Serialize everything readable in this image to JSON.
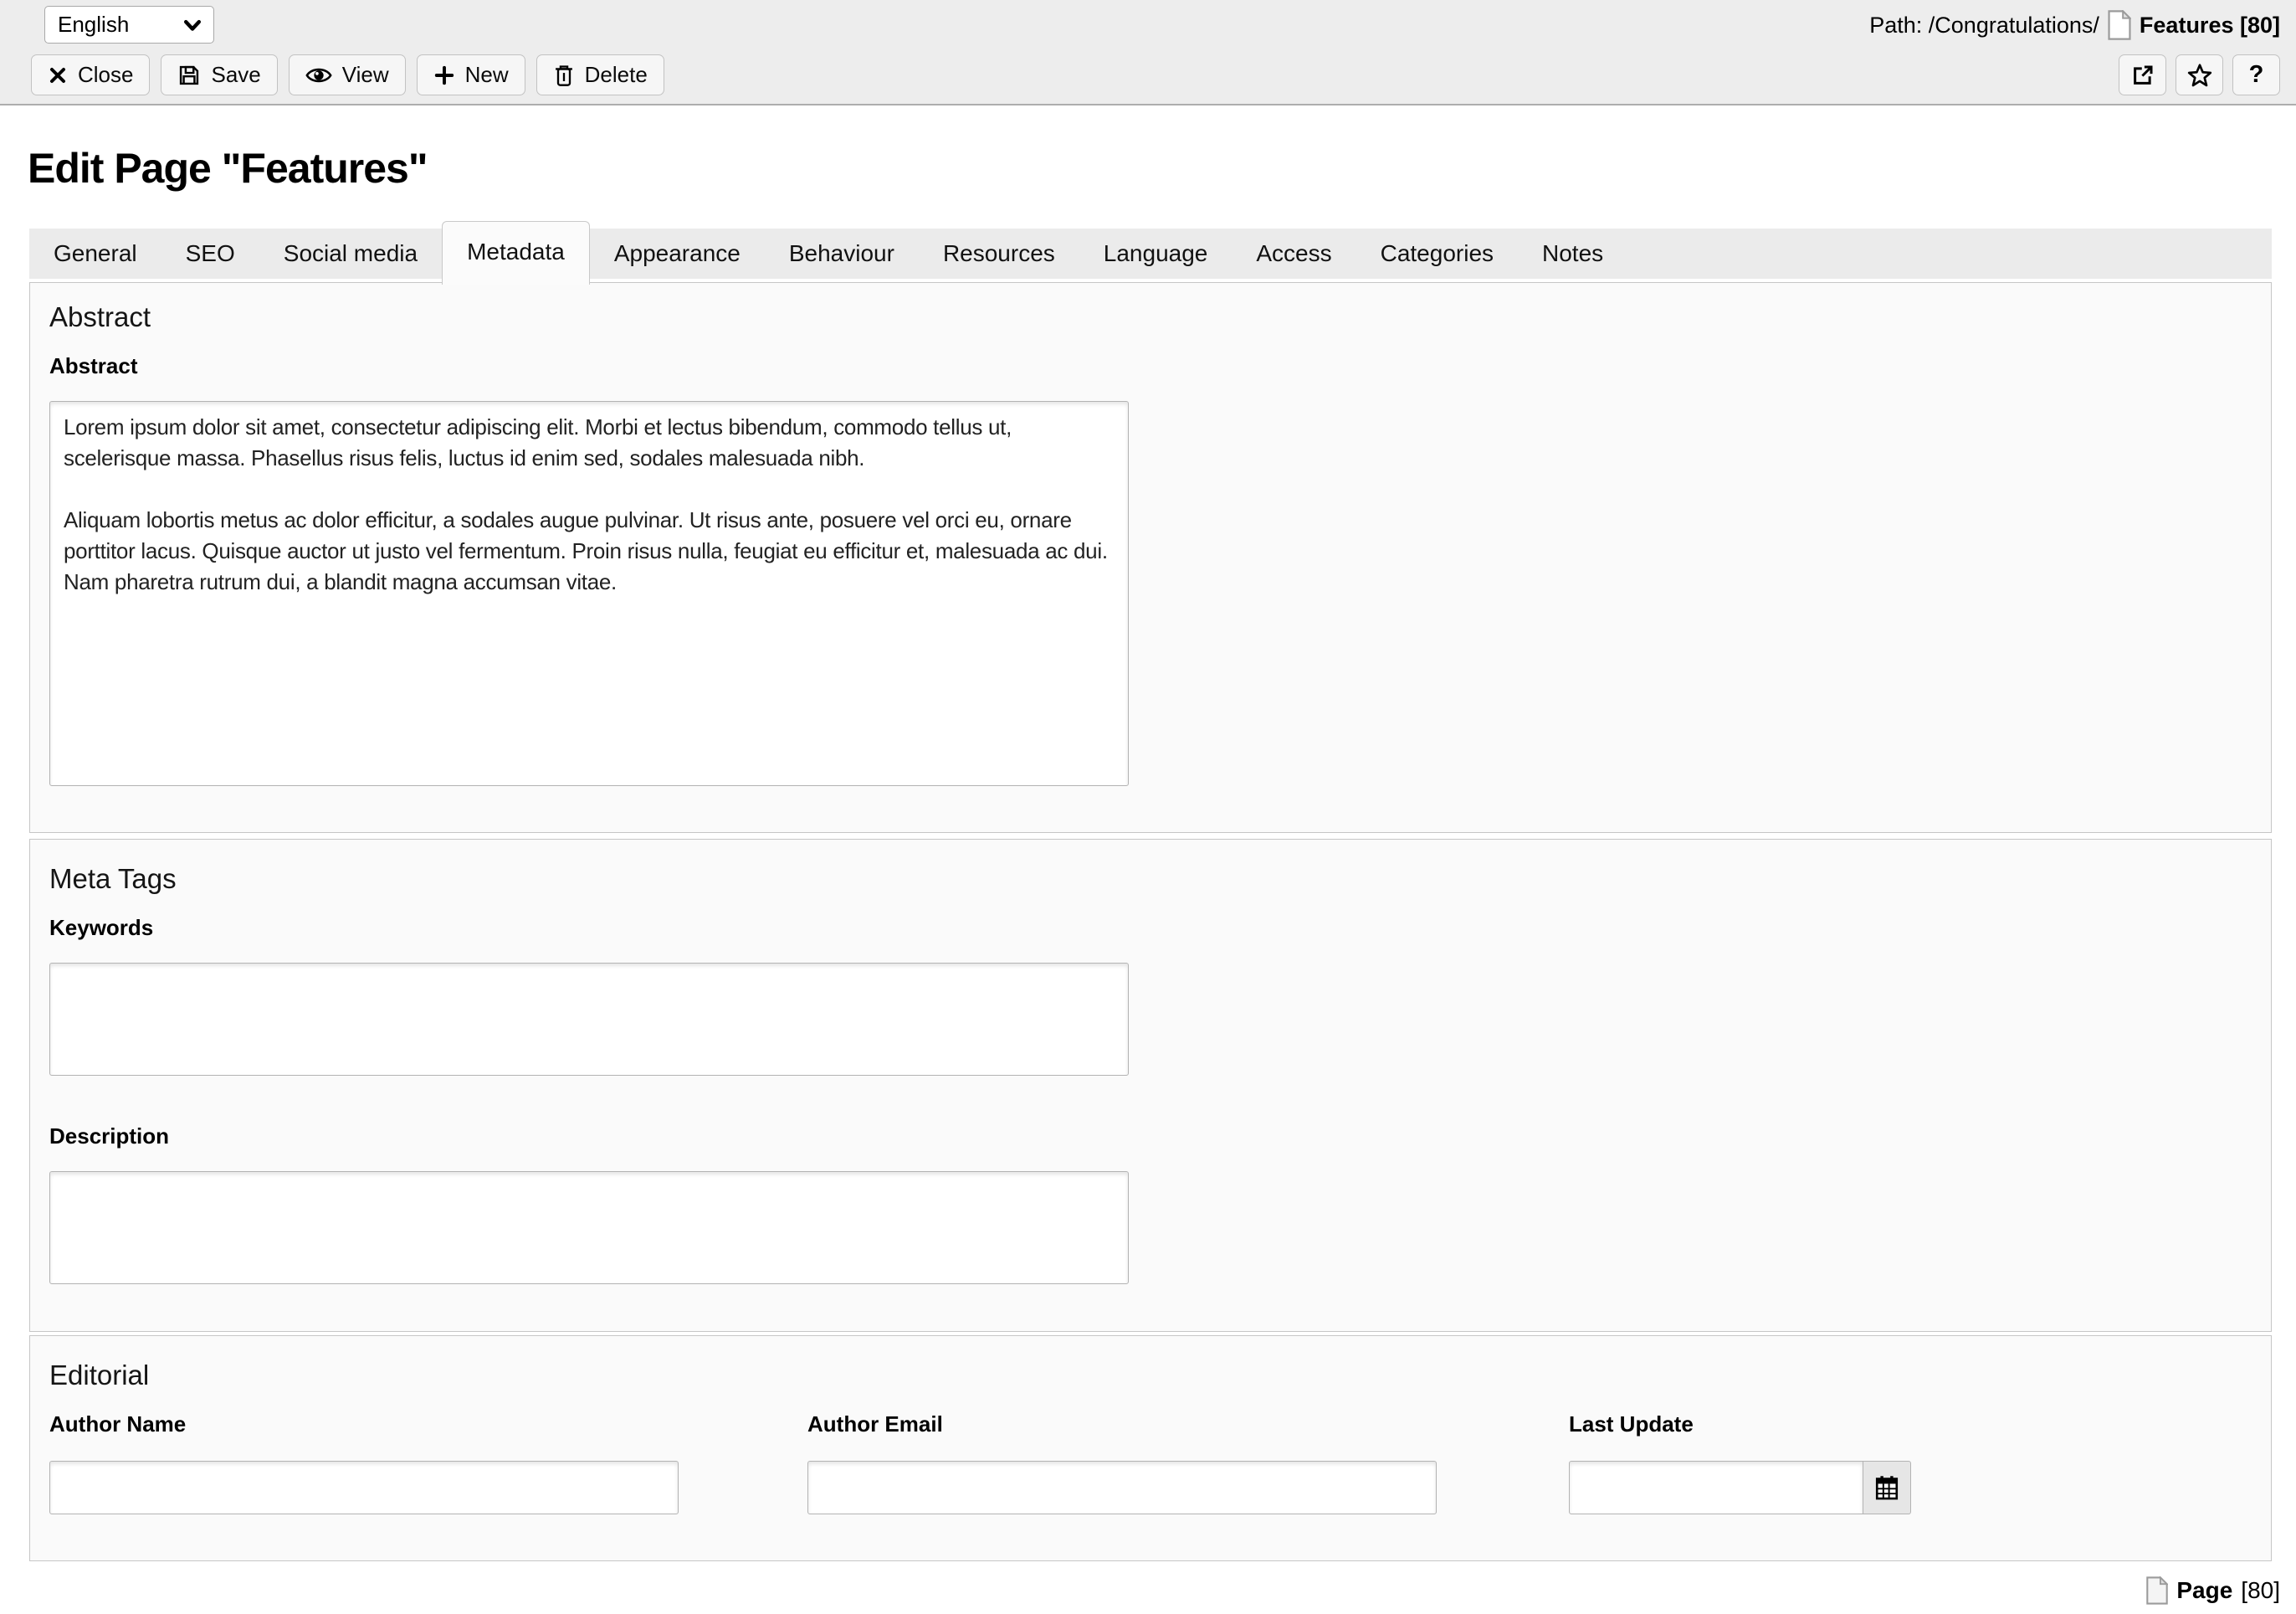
{
  "header": {
    "language": {
      "value": "English"
    },
    "path": {
      "label": "Path: /Congratulations/",
      "record": "Features [80]"
    },
    "toolbar": {
      "buttons": [
        {
          "label": "Close",
          "icon": "close-icon"
        },
        {
          "label": "Save",
          "icon": "save-icon"
        },
        {
          "label": "View",
          "icon": "eye-icon"
        },
        {
          "label": "New",
          "icon": "plus-icon"
        },
        {
          "label": "Delete",
          "icon": "trash-icon"
        }
      ],
      "quick_buttons": [
        {
          "icon": "external-link-icon"
        },
        {
          "icon": "star-icon"
        },
        {
          "icon": "question-mark",
          "label": "?"
        }
      ]
    }
  },
  "page": {
    "title": "Edit Page \"Features\"",
    "tabs": [
      {
        "label": "General",
        "active": false
      },
      {
        "label": "SEO",
        "active": false
      },
      {
        "label": "Social media",
        "active": false
      },
      {
        "label": "Metadata",
        "active": true
      },
      {
        "label": "Appearance",
        "active": false
      },
      {
        "label": "Behaviour",
        "active": false
      },
      {
        "label": "Resources",
        "active": false
      },
      {
        "label": "Language",
        "active": false
      },
      {
        "label": "Access",
        "active": false
      },
      {
        "label": "Categories",
        "active": false
      },
      {
        "label": "Notes",
        "active": false
      }
    ],
    "sections": {
      "abstract": {
        "heading": "Abstract",
        "field_label": "Abstract",
        "value": "Lorem ipsum dolor sit amet, consectetur adipiscing elit. Morbi et lectus bibendum, commodo tellus ut, scelerisque massa. Phasellus risus felis, luctus id enim sed, sodales malesuada nibh.\n\nAliquam lobortis metus ac dolor efficitur, a sodales augue pulvinar. Ut risus ante, posuere vel orci eu, ornare porttitor lacus. Quisque auctor ut justo vel fermentum. Proin risus nulla, feugiat eu efficitur et, malesuada ac dui. Nam pharetra rutrum dui, a blandit magna accumsan vitae."
      },
      "meta_tags": {
        "heading": "Meta Tags",
        "keywords_label": "Keywords",
        "keywords_value": "",
        "description_label": "Description",
        "description_value": ""
      },
      "editorial": {
        "heading": "Editorial",
        "author_name_label": "Author Name",
        "author_name_value": "",
        "author_email_label": "Author Email",
        "author_email_value": "",
        "last_update_label": "Last Update",
        "last_update_value": ""
      }
    }
  },
  "footer": {
    "record": "Page",
    "record_id": "[80]"
  }
}
